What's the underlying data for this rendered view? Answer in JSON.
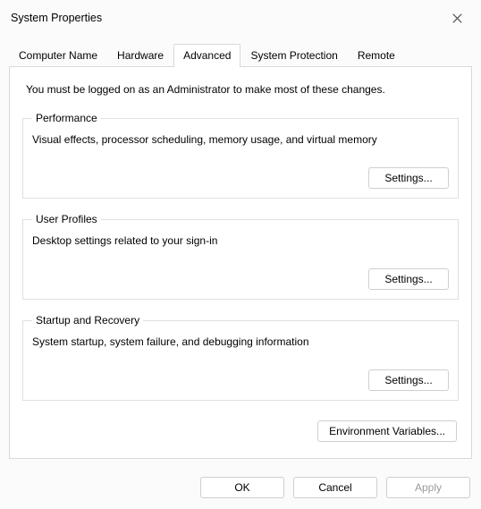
{
  "window": {
    "title": "System Properties"
  },
  "tabs": {
    "computer_name": "Computer Name",
    "hardware": "Hardware",
    "advanced": "Advanced",
    "system_protection": "System Protection",
    "remote": "Remote"
  },
  "admin_note": "You must be logged on as an Administrator to make most of these changes.",
  "groups": {
    "performance": {
      "legend": "Performance",
      "desc": "Visual effects, processor scheduling, memory usage, and virtual memory",
      "settings_label": "Settings..."
    },
    "user_profiles": {
      "legend": "User Profiles",
      "desc": "Desktop settings related to your sign-in",
      "settings_label": "Settings..."
    },
    "startup_recovery": {
      "legend": "Startup and Recovery",
      "desc": "System startup, system failure, and debugging information",
      "settings_label": "Settings..."
    }
  },
  "env_button": "Environment Variables...",
  "footer": {
    "ok": "OK",
    "cancel": "Cancel",
    "apply": "Apply"
  }
}
